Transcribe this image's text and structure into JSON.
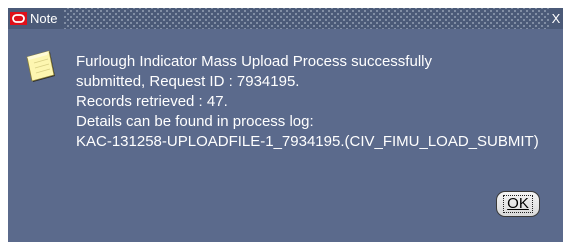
{
  "window": {
    "title": "Note",
    "close_glyph": "X"
  },
  "icons": {
    "app": "oracle-logo-icon",
    "message": "sticky-note-icon"
  },
  "message": {
    "line1": "Furlough Indicator Mass Upload Process successfully",
    "line2": "submitted, Request ID : 7934195.",
    "line3": "Records retrieved : 47.",
    "line4": "Details can be found in process log:",
    "line5": "KAC-131258-UPLOADFILE-1_7934195.(CIV_FIMU_LOAD_SUBMIT)"
  },
  "buttons": {
    "ok_label": "OK"
  },
  "colors": {
    "titlebar": "#4b5a78",
    "body": "#5b6a8c",
    "accent_red": "#e0101a"
  }
}
